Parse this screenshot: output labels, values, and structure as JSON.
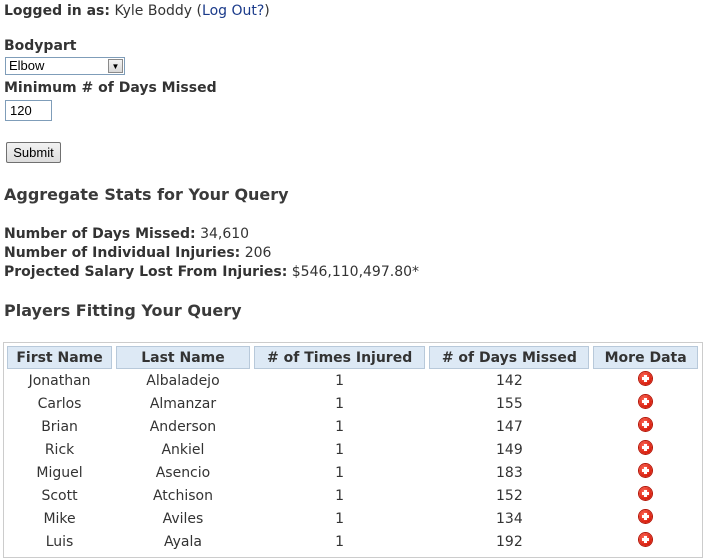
{
  "login": {
    "label": "Logged in as:",
    "user": "Kyle Boddy",
    "open_paren": "(",
    "logout": "Log Out?",
    "close_paren": ")"
  },
  "form": {
    "bodypart_label": "Bodypart",
    "bodypart_value": "Elbow",
    "days_label": "Minimum # of Days Missed",
    "days_value": "120",
    "submit_label": "Submit"
  },
  "aggregate": {
    "heading": "Aggregate Stats for Your Query",
    "days_missed_label": "Number of Days Missed:",
    "days_missed_value": "34,610",
    "injuries_label": "Number of Individual Injuries:",
    "injuries_value": "206",
    "salary_label": "Projected Salary Lost From Injuries:",
    "salary_value": "$546,110,497.80*"
  },
  "players": {
    "heading": "Players Fitting Your Query",
    "columns": [
      "First Name",
      "Last Name",
      "# of Times Injured",
      "# of Days Missed",
      "More Data"
    ],
    "rows": [
      [
        "Jonathan",
        "Albaladejo",
        "1",
        "142"
      ],
      [
        "Carlos",
        "Almanzar",
        "1",
        "155"
      ],
      [
        "Brian",
        "Anderson",
        "1",
        "147"
      ],
      [
        "Rick",
        "Ankiel",
        "1",
        "149"
      ],
      [
        "Miguel",
        "Asencio",
        "1",
        "183"
      ],
      [
        "Scott",
        "Atchison",
        "1",
        "152"
      ],
      [
        "Mike",
        "Aviles",
        "1",
        "134"
      ],
      [
        "Luis",
        "Ayala",
        "1",
        "192"
      ]
    ],
    "more_data_icon": "plus-circle-icon"
  }
}
